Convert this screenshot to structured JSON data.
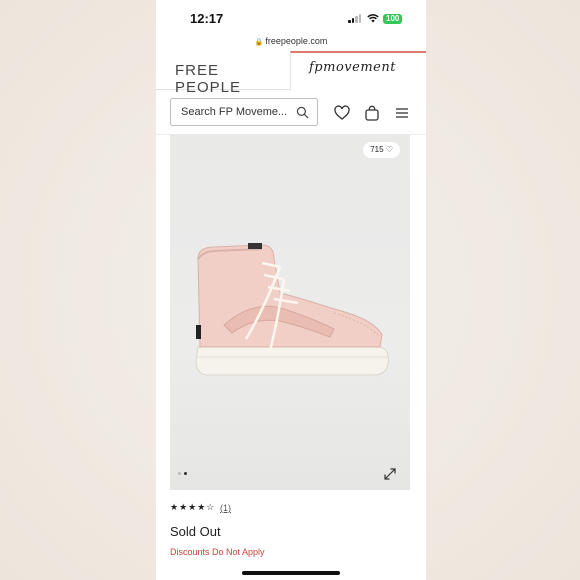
{
  "status_bar": {
    "time": "12:17",
    "battery": "100"
  },
  "browser": {
    "url": "freepeople.com"
  },
  "brand": {
    "left": "FREE PEOPLE",
    "right": "fpmovement"
  },
  "search": {
    "placeholder": "Search FP Moveme..."
  },
  "product": {
    "likes": "715",
    "rating_stars": "★★★★☆",
    "rating_value": 4,
    "review_count": "(1)",
    "availability": "Sold Out",
    "discount_note": "Discounts Do Not Apply",
    "image_count": 2,
    "current_image": 2
  },
  "colors": {
    "accent": "#e07a6e",
    "discount_text": "#c0453a",
    "battery": "#34c759",
    "shoe": "#f1cfc7"
  },
  "icons": [
    "lock-icon",
    "search-icon",
    "heart-icon",
    "bag-icon",
    "menu-icon",
    "heart-outline-icon",
    "expand-icon"
  ]
}
